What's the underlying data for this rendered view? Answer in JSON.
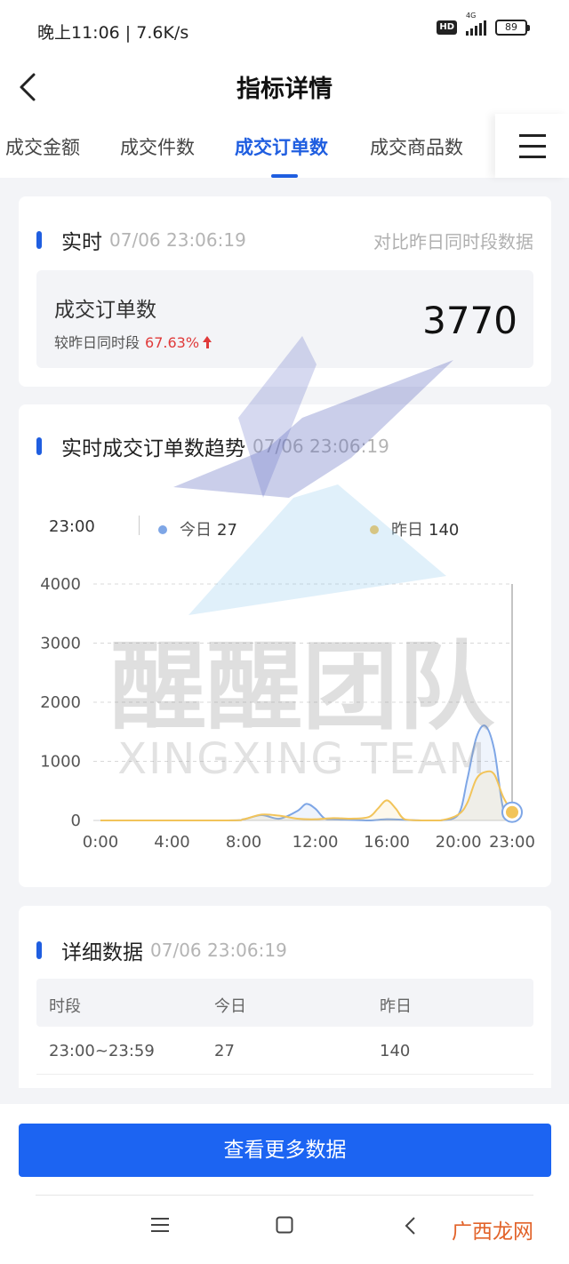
{
  "status_bar": {
    "time_speed": "晚上11:06 | 7.6K/s",
    "hd": "HD",
    "network": "4G",
    "battery": "89"
  },
  "header": {
    "title": "指标详情"
  },
  "tabs": [
    {
      "label": "成交金额"
    },
    {
      "label": "成交件数"
    },
    {
      "label": "成交订单数",
      "active": true
    },
    {
      "label": "成交商品数"
    }
  ],
  "realtime": {
    "title": "实时",
    "timestamp": "07/06 23:06:19",
    "note": "对比昨日同时段数据",
    "metric_name": "成交订单数",
    "compare_label": "较昨日同时段",
    "compare_pct": "67.63%",
    "compare_direction": "up",
    "value": "3770"
  },
  "trend": {
    "title": "实时成交订单数趋势",
    "timestamp": "07/06 23:06:19",
    "legend_time": "23:00",
    "legend": [
      {
        "label": "今日",
        "value": "27",
        "color": "#7ea6e6"
      },
      {
        "label": "昨日",
        "value": "140",
        "color": "#f2c45a"
      }
    ]
  },
  "chart_data": {
    "type": "line",
    "x_ticks": [
      "0:00",
      "4:00",
      "8:00",
      "12:00",
      "16:00",
      "20:00",
      "23:00"
    ],
    "y_ticks": [
      "0",
      "1000",
      "2000",
      "3000",
      "4000"
    ],
    "ylim": [
      0,
      4000
    ],
    "xlim": [
      0,
      23
    ],
    "grid": true,
    "series": [
      {
        "name": "今日",
        "color": "#7ea6e6",
        "points": [
          [
            0,
            0
          ],
          [
            7,
            0
          ],
          [
            8,
            20
          ],
          [
            9,
            90
          ],
          [
            10,
            30
          ],
          [
            11,
            160
          ],
          [
            11.5,
            280
          ],
          [
            12,
            200
          ],
          [
            12.5,
            40
          ],
          [
            13,
            20
          ],
          [
            14,
            10
          ],
          [
            15,
            0
          ],
          [
            16,
            20
          ],
          [
            17,
            10
          ],
          [
            18,
            0
          ],
          [
            19,
            0
          ],
          [
            20,
            100
          ],
          [
            20.5,
            700
          ],
          [
            21,
            1400
          ],
          [
            21.5,
            1600
          ],
          [
            22,
            1200
          ],
          [
            22.5,
            200
          ],
          [
            23,
            27
          ]
        ]
      },
      {
        "name": "昨日",
        "color": "#f2c45a",
        "points": [
          [
            0,
            0
          ],
          [
            7,
            0
          ],
          [
            8,
            20
          ],
          [
            9,
            100
          ],
          [
            10,
            80
          ],
          [
            11,
            30
          ],
          [
            12,
            20
          ],
          [
            13,
            40
          ],
          [
            14,
            30
          ],
          [
            15,
            60
          ],
          [
            15.5,
            200
          ],
          [
            16,
            340
          ],
          [
            16.5,
            200
          ],
          [
            17,
            20
          ],
          [
            18,
            0
          ],
          [
            19,
            0
          ],
          [
            20,
            100
          ],
          [
            20.5,
            300
          ],
          [
            21,
            700
          ],
          [
            21.5,
            820
          ],
          [
            22,
            780
          ],
          [
            22.5,
            400
          ],
          [
            23,
            140
          ]
        ]
      }
    ]
  },
  "detail": {
    "title": "详细数据",
    "timestamp": "07/06 23:06:19",
    "columns": [
      "时段",
      "今日",
      "昨日"
    ],
    "rows": [
      [
        "23:00~23:59",
        "27",
        "140"
      ]
    ]
  },
  "more_button": "查看更多数据",
  "watermark": {
    "main": "醒醒团队",
    "sub": "XINGXING TEAM",
    "corner": "广西龙网"
  }
}
